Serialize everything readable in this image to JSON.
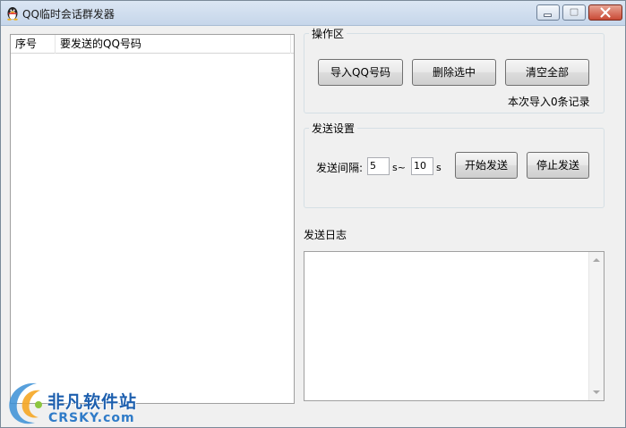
{
  "window": {
    "title": "QQ临时会话群发器",
    "icons": {
      "app": "qq-penguin-icon",
      "minimize": "minimize-icon",
      "maximize": "maximize-icon",
      "close": "close-icon"
    }
  },
  "list": {
    "columns": [
      "序号",
      "要发送的QQ号码"
    ],
    "rows": []
  },
  "operation_group": {
    "title": "操作区",
    "import_button": "导入QQ号码",
    "delete_button": "删除选中",
    "clear_button": "清空全部",
    "status": "本次导入0条记录"
  },
  "send_settings": {
    "title": "发送设置",
    "interval_label": "发送间隔:",
    "interval_min": "5",
    "interval_min_unit": "s~",
    "interval_max": "10",
    "interval_max_unit": "s",
    "start_button": "开始发送",
    "stop_button": "停止发送"
  },
  "log": {
    "label": "发送日志",
    "content": ""
  },
  "watermark": {
    "cn": "非凡软件站",
    "en": "CRSKY.com"
  }
}
